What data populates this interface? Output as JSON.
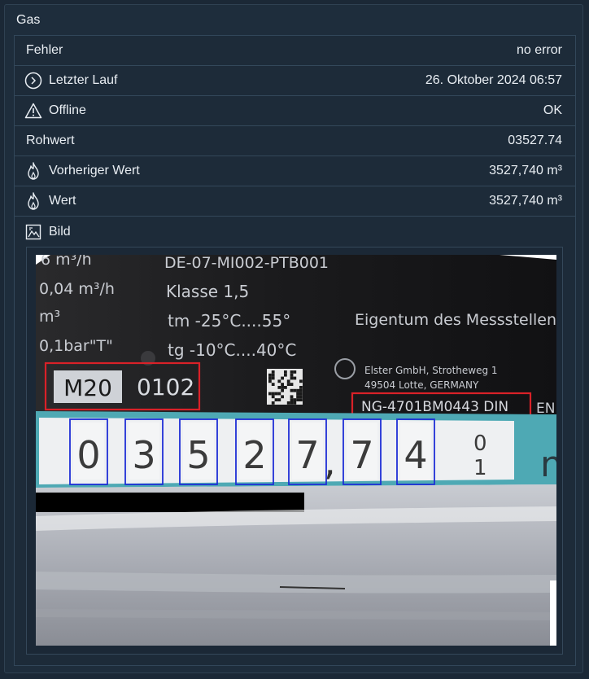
{
  "card": {
    "title": "Gas"
  },
  "rows": [
    {
      "label": "Fehler",
      "value": "no error",
      "icon": ""
    },
    {
      "label": "Letzter Lauf",
      "value": "26. Oktober 2024 06:57",
      "icon": "clock-icon"
    },
    {
      "label": "Offline",
      "value": "OK",
      "icon": "warning-icon"
    },
    {
      "label": "Rohwert",
      "value": "03527.74",
      "icon": ""
    },
    {
      "label": "Vorheriger Wert",
      "value": "3527,740 m³",
      "icon": "flame-icon"
    },
    {
      "label": "Wert",
      "value": "3527,740 m³",
      "icon": "flame-icon"
    },
    {
      "label": "Bild",
      "value": "",
      "icon": "image-icon"
    }
  ],
  "meter_image": {
    "plate_lines": [
      "6 m³/h",
      "0,04 m³/h",
      "m³",
      "0,1bar\"T\""
    ],
    "top_code": "DE-07-MI002-PTB001",
    "klasse": "Klasse 1,5",
    "tm": "tm -25°C....55°",
    "tg": "tg -10°C....40°C",
    "owner": "Eigentum des Messstellenbetre",
    "maker_line1": "Elster GmbH, Strotheweg 1",
    "maker_line2": "49504 Lotte, GERMANY",
    "model": "M20",
    "model_code": "0102",
    "serial": "NG-4701BM0443 DIN",
    "serial_suffix": "EN",
    "digits": [
      "0",
      "3",
      "5",
      "2",
      "7",
      "7",
      "4"
    ],
    "comma": ",",
    "unit_fragment": "n",
    "wheel_top": "0",
    "wheel_bottom": "1"
  }
}
